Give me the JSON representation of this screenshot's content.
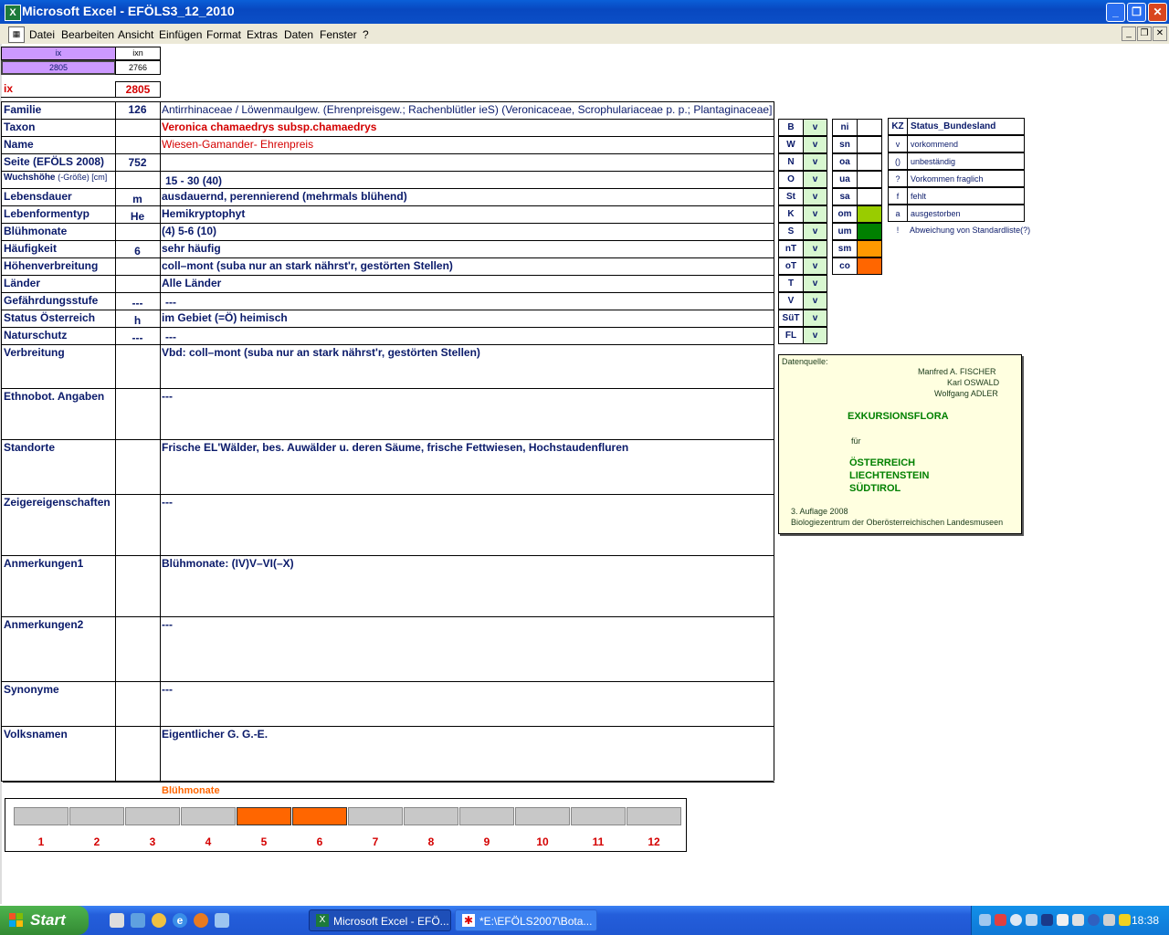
{
  "window": {
    "title": "Microsoft Excel - EFÖLS3_12_2010"
  },
  "menu": [
    "Datei",
    "Bearbeiten",
    "Ansicht",
    "Einfügen",
    "Format",
    "Extras",
    "Daten",
    "Fenster",
    "?"
  ],
  "top": {
    "ix_label": "ix",
    "ixn_label": "ixn",
    "ix_value": "2805",
    "ixn_value": "2766",
    "ix2_label": "ix",
    "ix2_value": "2805"
  },
  "rows": [
    {
      "label": "Familie",
      "code": "126",
      "value": "Antirrhinaceae  /  Löwenmaulgew. (Ehrenpreisgew.; Rachenblütler ieS) (Veronicaceae, Scrophulariaceae p. p.; Plantaginaceae]"
    },
    {
      "label": "Taxon",
      "code": "",
      "value": "Veronica chamaedrys subsp.chamaedrys"
    },
    {
      "label": "Name",
      "code": "",
      "value": "Wiesen-Gamander- Ehrenpreis"
    },
    {
      "label": "Seite (EFÖLS 2008)",
      "code": "752",
      "value": ""
    },
    {
      "label": "Wuchshöhe",
      "label_small": "(-Größe) [cm]",
      "code": "",
      "value": "15 - 30 (40)"
    },
    {
      "label": "Lebensdauer",
      "code": "m",
      "value": "ausdauernd, perennierend (mehrmals blühend)"
    },
    {
      "label": "Lebenformentyp",
      "code": "He",
      "value": "Hemikryptophyt"
    },
    {
      "label": "Blühmonate",
      "code": "",
      "value": "(4) 5-6 (10)"
    },
    {
      "label": "Häufigkeit",
      "code": "6",
      "value": "sehr häufig"
    },
    {
      "label": "Höhenverbreitung",
      "code": "",
      "value": "coll–mont (suba nur an stark nährst'r, gestörten Stellen)"
    },
    {
      "label": "Länder",
      "code": "",
      "value": "Alle Länder"
    },
    {
      "label": "Gefährdungsstufe",
      "code": "---",
      "value": "---"
    },
    {
      "label": "Status Österreich",
      "code": "h",
      "value": "im Gebiet (=Ö) heimisch"
    },
    {
      "label": "Naturschutz",
      "code": "---",
      "value": "---"
    },
    {
      "label": "Verbreitung",
      "code": "",
      "value": "Vbd:  coll–mont (suba nur an stark nährst'r, gestörten Stellen)"
    },
    {
      "label": "Ethnobot. Angaben",
      "code": "",
      "value": "---"
    },
    {
      "label": "Standorte",
      "code": "",
      "value": "Frische EL'Wälder, bes. Auwälder u. deren Säume, frische Fettwiesen, Hochstaudenfluren"
    },
    {
      "label": "Zeigereigenschaften",
      "code": "",
      "value": "---"
    },
    {
      "label": "Anmerkungen1",
      "code": "",
      "value": "Blühmonate: (IV)V–VI(–X)"
    },
    {
      "label": "Anmerkungen2",
      "code": "",
      "value": "---"
    },
    {
      "label": "Synonyme",
      "code": "",
      "value": "---"
    },
    {
      "label": "Volksnamen",
      "code": "",
      "value": "Eigentlicher G. G.-E."
    }
  ],
  "states": [
    {
      "code": "B",
      "v": "v"
    },
    {
      "code": "W",
      "v": "v"
    },
    {
      "code": "N",
      "v": "v"
    },
    {
      "code": "O",
      "v": "v"
    },
    {
      "code": "St",
      "v": "v"
    },
    {
      "code": "K",
      "v": "v"
    },
    {
      "code": "S",
      "v": "v"
    },
    {
      "code": "nT",
      "v": "v"
    },
    {
      "code": "oT",
      "v": "v"
    },
    {
      "code": "T",
      "v": "v"
    },
    {
      "code": "V",
      "v": "v"
    },
    {
      "code": "SüT",
      "v": "v"
    },
    {
      "code": "FL",
      "v": "v"
    }
  ],
  "zones": [
    {
      "code": "ni",
      "color": ""
    },
    {
      "code": "sn",
      "color": ""
    },
    {
      "code": "oa",
      "color": ""
    },
    {
      "code": "ua",
      "color": ""
    },
    {
      "code": "sa",
      "color": ""
    },
    {
      "code": "om",
      "color": "#99cc00"
    },
    {
      "code": "um",
      "color": "#008000"
    },
    {
      "code": "sm",
      "color": "#ff9900"
    },
    {
      "code": "co",
      "color": "#ff6600"
    }
  ],
  "legend": {
    "header_kz": "KZ",
    "header_status": "Status_Bundesland",
    "items": [
      {
        "kz": "v",
        "text": "vorkommend"
      },
      {
        "kz": "()",
        "text": "unbeständig"
      },
      {
        "kz": "?",
        "text": "Vorkommen fraglich"
      },
      {
        "kz": "f",
        "text": "fehlt"
      },
      {
        "kz": "a",
        "text": "ausgestorben"
      },
      {
        "kz": "!",
        "text": "Abweichung von Standardliste(?)"
      }
    ]
  },
  "book": {
    "source": "Datenquelle:",
    "authors": [
      "Manfred A. FISCHER",
      "Karl OSWALD",
      "Wolfgang ADLER"
    ],
    "title": "EXKURSIONSFLORA",
    "fuer": "für",
    "countries": [
      "ÖSTERREICH",
      "LIECHTENSTEIN",
      "SÜDTIROL"
    ],
    "edition": "3. Auflage 2008",
    "publisher": "Biologiezentrum der Oberösterreichischen Landesmuseen"
  },
  "bloom": {
    "title": "Blühmonate",
    "months": [
      "1",
      "2",
      "3",
      "4",
      "5",
      "6",
      "7",
      "8",
      "9",
      "10",
      "11",
      "12"
    ],
    "active": [
      5,
      6
    ]
  },
  "taskbar": {
    "start": "Start",
    "tasks": [
      "Microsoft Excel - EFÖ...",
      "*E:\\EFÖLS2007\\Bota..."
    ],
    "time": "18:38"
  }
}
